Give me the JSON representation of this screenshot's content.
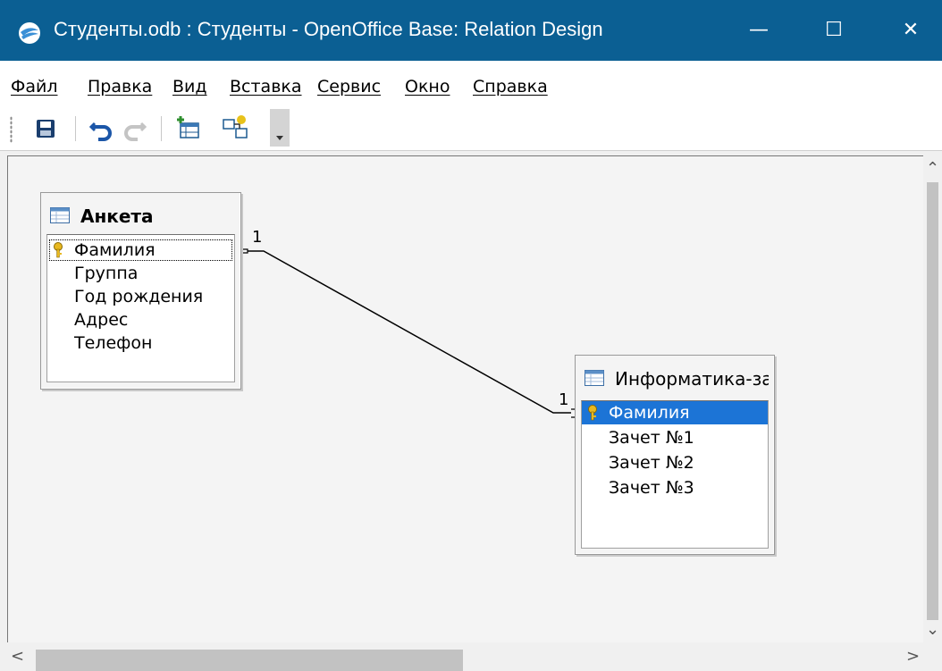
{
  "window": {
    "title": "Студенты.odb : Студенты - OpenOffice Base: Relation Design",
    "minimize": "—",
    "maximize": "☐",
    "close": "✕"
  },
  "menu": [
    "Файл",
    "Правка",
    "Вид",
    "Вставка",
    "Сервис",
    "Окно",
    "Справка"
  ],
  "toolbar": {
    "icons": [
      "save-icon",
      "undo-icon",
      "redo-icon",
      "new-table-icon",
      "new-relation-icon",
      "dropdown-icon"
    ]
  },
  "tables": [
    {
      "title": "Анкета",
      "fields": [
        {
          "name": "Фамилия",
          "key": true,
          "selected": false,
          "focused": true
        },
        {
          "name": "Группа",
          "key": false
        },
        {
          "name": "Год рождения",
          "key": false
        },
        {
          "name": "Адрес",
          "key": false
        },
        {
          "name": "Телефон",
          "key": false
        }
      ]
    },
    {
      "title": "Информатика-за",
      "fields": [
        {
          "name": "Фамилия",
          "key": true,
          "selected": true
        },
        {
          "name": "Зачет №1",
          "key": false
        },
        {
          "name": "Зачет №2",
          "key": false
        },
        {
          "name": "Зачет №3",
          "key": false
        }
      ]
    }
  ],
  "relation": {
    "left_cardinality": "1",
    "right_cardinality": "1"
  },
  "colors": {
    "titlebar": "#0b5f93",
    "selection": "#1c74d6"
  }
}
